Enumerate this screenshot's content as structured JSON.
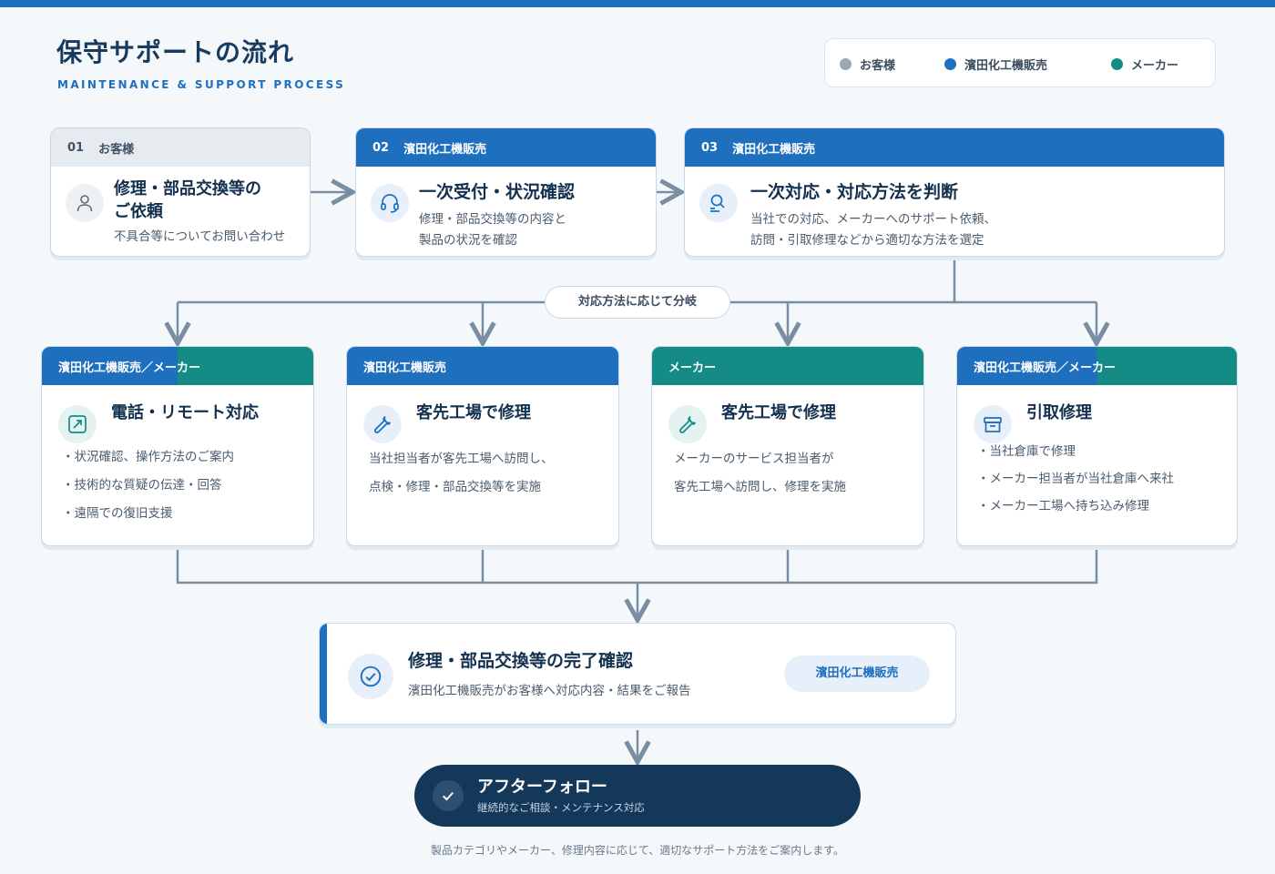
{
  "header": {
    "title": "保守サポートの流れ",
    "subtitle": "MAINTENANCE & SUPPORT PROCESS"
  },
  "colors": {
    "customer": "#9aa8b6",
    "hamada": "#1e6fbe",
    "maker": "#148b85",
    "navy": "#14385a"
  },
  "legend": [
    {
      "label": "お客様",
      "color": "#9aa8b6"
    },
    {
      "label": "濱田化工機販売",
      "color": "#1e6fbe"
    },
    {
      "label": "メーカー",
      "color": "#148b85"
    }
  ],
  "steps": [
    {
      "num": "01",
      "actor": "お客様",
      "title_line1": "修理・部品交換等の",
      "title_line2": "ご依頼",
      "desc": "不具合等についてお問い合わせ",
      "icon": "person-icon"
    },
    {
      "num": "02",
      "actor": "濱田化工機販売",
      "title": "一次受付・状況確認",
      "desc_line1": "修理・部品交換等の内容と",
      "desc_line2": "製品の状況を確認",
      "icon": "headset-icon"
    },
    {
      "num": "03",
      "actor": "濱田化工機販売",
      "title": "一次対応・対応方法を判断",
      "desc_line1": "当社での対応、メーカーへのサポート依頼、",
      "desc_line2": "訪問・引取修理などから適切な方法を選定",
      "icon": "search-person-icon"
    }
  ],
  "branch_label": "対応方法に応じて分岐",
  "options": [
    {
      "actor": "濱田化工機販売／メーカー",
      "title": "電話・リモート対応",
      "bullets": [
        "状況確認、操作方法のご案内",
        "技術的な質疑の伝達・回答",
        "遠隔での復旧支援"
      ],
      "icon": "remote-icon"
    },
    {
      "actor": "濱田化工機販売",
      "title": "客先工場で修理",
      "desc_line1": "当社担当者が客先工場へ訪問し、",
      "desc_line2": "点検・修理・部品交換等を実施",
      "icon": "wrench-icon"
    },
    {
      "actor": "メーカー",
      "title": "客先工場で修理",
      "desc_line1": "メーカーのサービス担当者が",
      "desc_line2": "客先工場へ訪問し、修理を実施",
      "icon": "wrench-icon"
    },
    {
      "actor": "濱田化工機販売／メーカー",
      "title": "引取修理",
      "bullets": [
        "当社倉庫で修理",
        "メーカー担当者が当社倉庫へ来社",
        "メーカー工場へ持ち込み修理"
      ],
      "icon": "box-icon"
    }
  ],
  "completion": {
    "title": "修理・部品交換等の完了確認",
    "desc": "濱田化工機販売がお客様へ対応内容・結果をご報告",
    "badge": "濱田化工機販売",
    "icon": "check-circle-icon"
  },
  "after_follow": {
    "title": "アフターフォロー",
    "subtitle": "継続的なご相談・メンテナンス対応",
    "icon": "check-icon"
  },
  "footnote": "製品カテゴリやメーカー、修理内容に応じて、適切なサポート方法をご案内します。"
}
